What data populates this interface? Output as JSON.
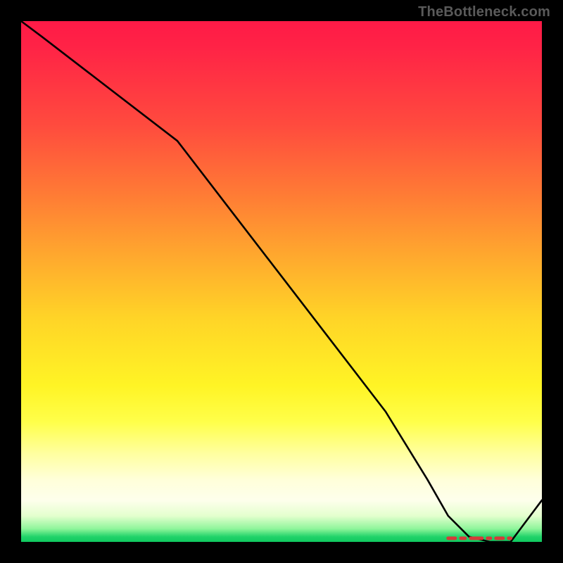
{
  "watermark": "TheBottleneck.com",
  "colors": {
    "page_bg": "#000000",
    "curve": "#000000",
    "marker": "#d43a3a",
    "gradient_top": "#ff1a47",
    "gradient_bottom": "#0fc95f"
  },
  "chart_data": {
    "type": "line",
    "title": "",
    "xlabel": "",
    "ylabel": "",
    "xlim": [
      0,
      100
    ],
    "ylim": [
      0,
      100
    ],
    "grid": false,
    "x": [
      0,
      4,
      30,
      40,
      50,
      60,
      70,
      78,
      82,
      86,
      90,
      94,
      100
    ],
    "values": [
      100,
      97,
      77,
      64,
      51,
      38,
      25,
      12,
      5,
      1,
      0,
      0,
      8
    ],
    "annotations": [
      {
        "kind": "optimum-range",
        "x_start": 82,
        "x_end": 94,
        "y": 0
      }
    ]
  }
}
